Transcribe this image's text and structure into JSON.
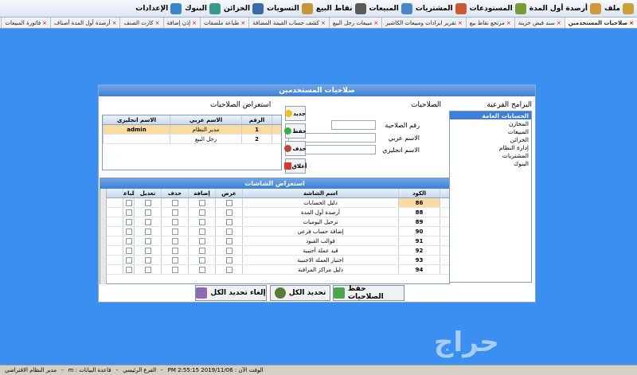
{
  "menu": [
    {
      "label": "ملف",
      "icon": "logo-icon",
      "color": "#caa23a"
    },
    {
      "label": "أرصدة أول المدة",
      "icon": "folder-icon",
      "color": "#d09a3a"
    },
    {
      "label": "المستودعات",
      "icon": "warehouse-icon",
      "color": "#7a9a3a"
    },
    {
      "label": "المشتريات",
      "icon": "cart-icon",
      "color": "#c85a3a"
    },
    {
      "label": "المبيعات",
      "icon": "monitor-icon",
      "color": "#4a86c8"
    },
    {
      "label": "نقاط البيع",
      "icon": "pos-icon",
      "color": "#5a5a5a"
    },
    {
      "label": "التسويات",
      "icon": "adjust-icon",
      "color": "#c8963a"
    },
    {
      "label": "الخزائن",
      "icon": "safe-icon",
      "color": "#3a6aa8"
    },
    {
      "label": "البنوك",
      "icon": "bank-icon",
      "color": "#3a9a8a"
    },
    {
      "label": "الإعدادات",
      "icon": "settings-icon",
      "color": "#3a86c8"
    }
  ],
  "tabs": [
    {
      "label": "صلاحيات المستخدمين",
      "active": true
    },
    {
      "label": "سند قبض خزينة",
      "active": false
    },
    {
      "label": "مرتجع نقاط بيع",
      "active": false
    },
    {
      "label": "تقرير ايرادات ومبيعات الكاشير",
      "active": false
    },
    {
      "label": "مبيعات رجل البيع",
      "active": false
    },
    {
      "label": "كشف حساب القيمة المضافة",
      "active": false
    },
    {
      "label": "طباعة ملصقات",
      "active": false
    },
    {
      "label": "إذن إضافة",
      "active": false
    },
    {
      "label": "كارت الصنف",
      "active": false
    },
    {
      "label": "أرصدة أول المدة أصناف",
      "active": false
    },
    {
      "label": "فاتورة المبيعات",
      "active": false
    },
    {
      "label": "أضافة عميل",
      "active": false
    }
  ],
  "window": {
    "title": "صلاحيات المستخدمين",
    "subprograms_title": "البرامج الفرعية",
    "subprograms": [
      "الحسابات العامة",
      "المخازن",
      "المبيعات",
      "الخزائن",
      "إدارة النظام",
      "المشتريات",
      "البنوك"
    ],
    "subprograms_selected": 0,
    "permissions_title": "الصلاحيات",
    "perm_fields": [
      {
        "label": "رقم الصلاحية",
        "value": ""
      },
      {
        "label": "الاسم عربي",
        "value": ""
      },
      {
        "label": "الاسم انجليزي",
        "value": ""
      }
    ],
    "browse_title": "استعراض الصلاحيات",
    "browse_headers": {
      "num": "الرقم",
      "ar": "الاسم عربي",
      "en": "الاسم انجليزي"
    },
    "browse_rows": [
      {
        "num": "1",
        "ar": "مدير النظام",
        "en": "admin"
      },
      {
        "num": "2",
        "ar": "رجل البيع",
        "en": ""
      }
    ],
    "buttons": {
      "new": "جديد",
      "save": "حفظ",
      "delete": "حذف",
      "close": "أغلاق"
    },
    "screens_title": "استعراض الشاشات",
    "screen_headers": {
      "code": "الكود",
      "name": "اسم الشاشة",
      "view": "عرض",
      "add": "إضافة",
      "del": "حذف",
      "edit": "تعديل",
      "print": "طباعة"
    },
    "screens": [
      {
        "code": "86",
        "name": "دليل الحسابات"
      },
      {
        "code": "88",
        "name": "أرصدة أول المدة"
      },
      {
        "code": "89",
        "name": "ترحيل اليوميات"
      },
      {
        "code": "90",
        "name": "إضافة حساب فرعي"
      },
      {
        "code": "91",
        "name": "قوالب القيود"
      },
      {
        "code": "92",
        "name": "قيد عملة أجنبية"
      },
      {
        "code": "93",
        "name": "اختيار العملة الاجنبية"
      },
      {
        "code": "94",
        "name": "دليل مراكز المراقبة"
      }
    ],
    "bottom": {
      "save_perms": "حفظ الصلاحيات",
      "select_all": "تحديد الكل",
      "unselect_all": "إلغاء تحديد الكل"
    }
  },
  "status": {
    "user": "مدير النظام الافتراضي",
    "db": "قاعدة البيانات : m",
    "branch": "الفرع الرئيسي",
    "time": "الوقت الآن : PM 2:55:15 2019/11/06"
  },
  "watermark": "حراج",
  "colors": {
    "accent": "#3a8ff0",
    "title_bar": "#3d7fd8",
    "selected_row": "#fbdca0"
  }
}
